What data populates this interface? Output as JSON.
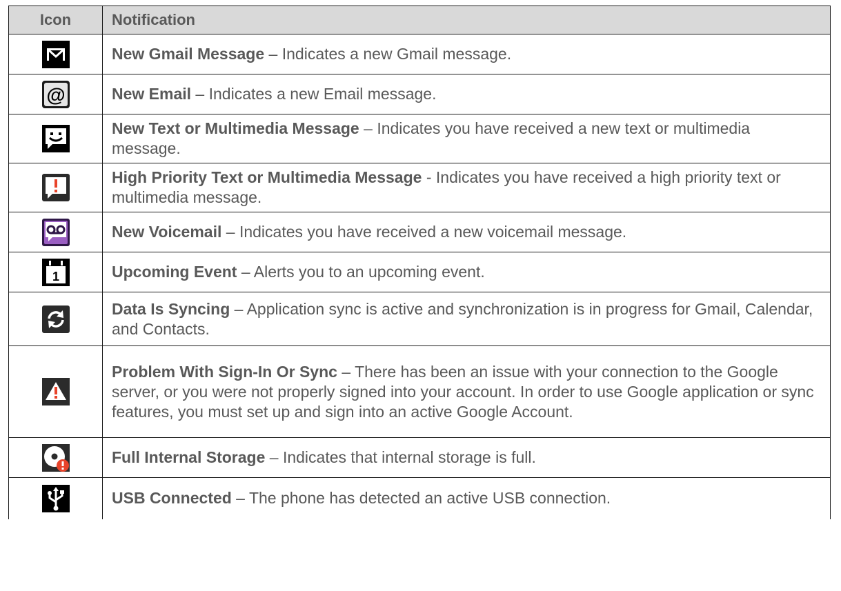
{
  "header": {
    "icon": "Icon",
    "notification": "Notification"
  },
  "rows": [
    {
      "icon": "gmail-icon",
      "title": "New Gmail Message",
      "sep": " – ",
      "desc": "Indicates a new Gmail message."
    },
    {
      "icon": "email-at-icon",
      "title": "New Email",
      "sep": " – ",
      "desc": "Indicates a new Email message."
    },
    {
      "icon": "text-message-icon",
      "title": "New Text or Multimedia Message",
      "sep": " – ",
      "desc": "Indicates you have received a new text or multimedia message."
    },
    {
      "icon": "high-priority-message-icon",
      "title": "High Priority Text or Multimedia Message",
      "sep": " - ",
      "desc": "Indicates you have received a high priority text or multimedia message."
    },
    {
      "icon": "voicemail-icon",
      "title": "New Voicemail",
      "sep": " – ",
      "desc": "Indicates you have received a new voicemail message."
    },
    {
      "icon": "calendar-icon",
      "title": "Upcoming Event",
      "sep": " – ",
      "desc": "Alerts you to an upcoming event."
    },
    {
      "icon": "sync-icon",
      "title": "Data Is Syncing",
      "sep": " – ",
      "desc": "Application sync is active and synchronization is in progress for Gmail, Calendar, and Contacts."
    },
    {
      "icon": "warning-icon",
      "title": "Problem With Sign-In Or Sync",
      "sep": " – ",
      "desc": "There has been an issue with your connection to the Google server, or you were not properly signed into your account. In order to use Google application or sync features, you must set up and sign into an active Google Account."
    },
    {
      "icon": "storage-full-icon",
      "title": "Full Internal Storage",
      "sep": " – ",
      "desc": "Indicates that internal storage is full."
    },
    {
      "icon": "usb-icon",
      "title": "USB Connected",
      "sep": " – ",
      "desc": "The phone has detected an active USB connection."
    }
  ],
  "icon_glyphs": {
    "calendar_day": "1"
  },
  "colors": {
    "header_bg": "#d9d9d9",
    "text": "#595959",
    "alert_red": "#e8432a",
    "voicemail_bg": "#2e1747"
  }
}
